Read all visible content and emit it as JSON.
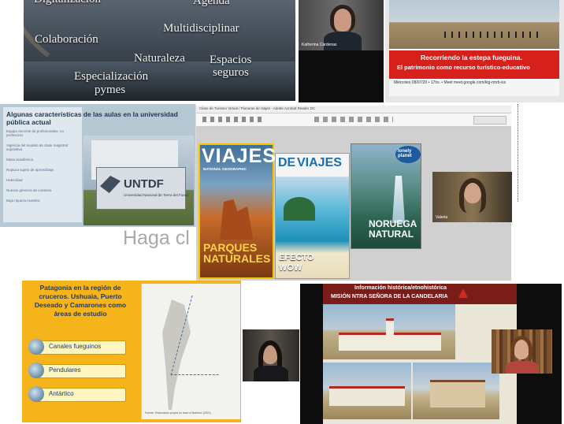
{
  "slide1": {
    "words": {
      "digitalizacion": "Digitalización",
      "agenda": "Agenda",
      "colaboracion": "Colaboración",
      "multidisciplinar": "Multidisciplinar",
      "naturaleza": "Naturaleza",
      "espacios": "Espacios",
      "seguros": "seguros",
      "especializacion": "Especialización",
      "pymes": "pymes"
    }
  },
  "cam1": {
    "name": "Katherina Cárdenas"
  },
  "estepa": {
    "title": "Recorriendo la estepa fueguina.",
    "subtitle": "El patrimonio como recurso turístico-educativo",
    "date_line": "Miércoles 08/07/20 • 17hs. • Meet meet.google.com/ktg-rmrb-iss"
  },
  "untdf": {
    "heading": "Algunas características de las aulas en la universidad pública actual",
    "bullets": [
      "Equipo docente de profesionales, no profesores",
      "Vigencia del modelo de clase magistral expositiva",
      "Masa académica",
      "Ruptura sujeto de aprendizaje",
      "Heteroliad",
      "Nuevos géneros de contexto",
      "Baja riqueza muestra"
    ],
    "sign": "UNTDF",
    "sign_sub": "Universidad Nacional de Tierra del Fuego"
  },
  "mags": {
    "window_title": "Clase de Turismo Virtual / Pioneras de Viajes - Adobe Acrobat Reader DC",
    "mag1": {
      "title": "VIAJES",
      "brand": "NATIONAL GEOGRAPHIC",
      "cover_line1": "PARQUES",
      "cover_line2": "NATURALES"
    },
    "mag2": {
      "title_de": "DE",
      "title_main": "VIAJES",
      "cover_line1": "EFECTO",
      "cover_line2": "WOW"
    },
    "mag3": {
      "brand": "lonely planet",
      "cover_line1": "NORUEGA",
      "cover_line2": "NATURAL"
    }
  },
  "cam2": {
    "name": "Valeria"
  },
  "overlay_text": "Haga cl",
  "patagonia": {
    "heading": "Patagonia en la región de cruceros. Ushuaia, Puerto Deseado y Camarones como áreas de estudio",
    "items": [
      "Canales fueguinos",
      "Pendulares",
      "Antártico"
    ],
    "map_caption": "Fuente: Elaboración propia en base a Martinez (2021)"
  },
  "hist": {
    "heading": "Información histórica/etnohistórica",
    "subheading": "MISIÓN NTRA SEÑORA DE LA CANDELARIA"
  },
  "colors": {
    "estepa_red": "#d5201c",
    "patagonia_yellow": "#f4b41a",
    "hist_header": "#7a1d18"
  }
}
